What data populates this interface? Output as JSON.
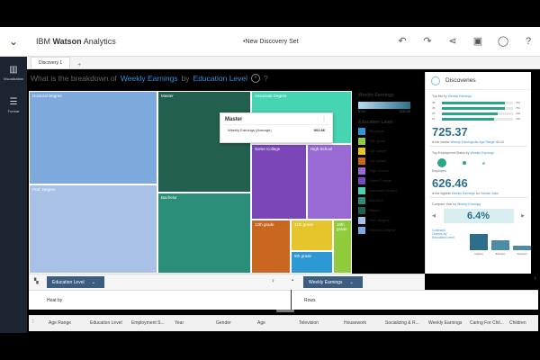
{
  "app": {
    "brand_prefix": "IBM ",
    "brand_bold": "Watson",
    "brand_suffix": " Analytics",
    "doc_title": "•New Discovery Set"
  },
  "header_icons": [
    "undo-icon",
    "redo-icon",
    "share-icon",
    "present-icon",
    "user-icon",
    "help-icon"
  ],
  "rail": {
    "items": [
      {
        "label": "Visualization",
        "icon": "chart-icon"
      },
      {
        "label": "Format",
        "icon": "sliders-icon"
      }
    ]
  },
  "tabs": {
    "active": "Discovery 1",
    "add": "+"
  },
  "question": {
    "prefix": "What is the breakdown of",
    "measure": "Weekly Earnings",
    "by": "by",
    "dimension": "Education Level",
    "clear": "×",
    "help": "?"
  },
  "treemap": {
    "cells": [
      {
        "label": "Doctoral Degree",
        "color": "#7ea9dc"
      },
      {
        "label": "Prof. Degree",
        "color": "#a9c1e6"
      },
      {
        "label": "Master",
        "color": "#235f4e"
      },
      {
        "label": "Bachelor",
        "color": "#2a8e79"
      },
      {
        "label": "Associate Degree",
        "color": "#46d4b3"
      },
      {
        "label": "Some College",
        "color": "#7b46b8"
      },
      {
        "label": "High School",
        "color": "#9a6ad4"
      },
      {
        "label": "12th grade",
        "color": "#c9661f"
      },
      {
        "label": "11th grade",
        "color": "#e6c52c"
      },
      {
        "label": "10th grade",
        "color": "#8fcb3b"
      },
      {
        "label": "9th grade",
        "color": "#2d99d4"
      }
    ]
  },
  "tooltip": {
    "title": "Master",
    "metric": "Weekly Earnings (Average)",
    "value": "902.86",
    "more": "⋮"
  },
  "legend": {
    "measure_title": "Weekly Earnings",
    "min": "$724",
    "max": "1022.00",
    "category_title": "Education Level",
    "items": [
      {
        "label": "9th grade",
        "color": "#2d99d4"
      },
      {
        "label": "10th grade",
        "color": "#8fcb3b"
      },
      {
        "label": "11th grade",
        "color": "#e6c52c"
      },
      {
        "label": "12th grade",
        "color": "#c9661f"
      },
      {
        "label": "High School",
        "color": "#9a6ad4"
      },
      {
        "label": "Some College",
        "color": "#7b46b8"
      },
      {
        "label": "Associate Degree",
        "color": "#46d4b3"
      },
      {
        "label": "Bachelor",
        "color": "#2a8e79"
      },
      {
        "label": "Master",
        "color": "#235f4e"
      },
      {
        "label": "Prof. Degree",
        "color": "#a9c1e6"
      },
      {
        "label": "Doctoral Degree",
        "color": "#7ea9dc"
      }
    ]
  },
  "shelves": {
    "color_by": "Education Level",
    "size_by": "Weekly Earnings",
    "heat_by": "Heat by",
    "rows": "Rows"
  },
  "columns": [
    "Age Range",
    "Education Level",
    "Employment S...",
    "Year",
    "Gender",
    "Age",
    "Television",
    "Housework",
    "Socializing & R...",
    "Weekly Earnings",
    "Caring For Chil...",
    "Children"
  ],
  "discoveries": {
    "title": "Discoveries",
    "card1": {
      "caption_prefix": "Top five by",
      "caption_kw": "Weekly Earnings",
      "bars": [
        {
          "name": "45",
          "value": "754",
          "fraction": 0.88
        },
        {
          "name": "35",
          "value": "754",
          "fraction": 0.88
        },
        {
          "name": "25",
          "value": "705",
          "fraction": 0.78
        },
        {
          "name": "15",
          "value": "705",
          "fraction": 0.74
        }
      ],
      "big": "725.37",
      "sub_prefix": "is the lowest",
      "sub_kw1": "Weekly Earnings",
      "sub_mid": "for",
      "sub_kw2": "Age Range",
      "sub_suffix": "40-44"
    },
    "card2": {
      "caption_prefix": "Top Employment Status by",
      "caption_kw": "Weekly Earnings",
      "dot_labels": [
        "Employed",
        "",
        ""
      ],
      "big": "626.46",
      "sub_prefix": "is the highest",
      "sub_kw1": "Weekly Earnings",
      "sub_mid": "for",
      "sub_kw2": "Gender Male"
    },
    "card3": {
      "caption_prefix": "Compare Year by",
      "caption_kw": "Weekly Earnings",
      "pct": "6.4%",
      "mini_caption": "Contracts Chimes by Education Level",
      "mini_bars": [
        {
          "label": "Highest",
          "fraction": 0.75
        },
        {
          "label": "Bachelor",
          "fraction": 0.45
        },
        {
          "label": "Wrapped",
          "fraction": 0.2
        }
      ]
    }
  }
}
